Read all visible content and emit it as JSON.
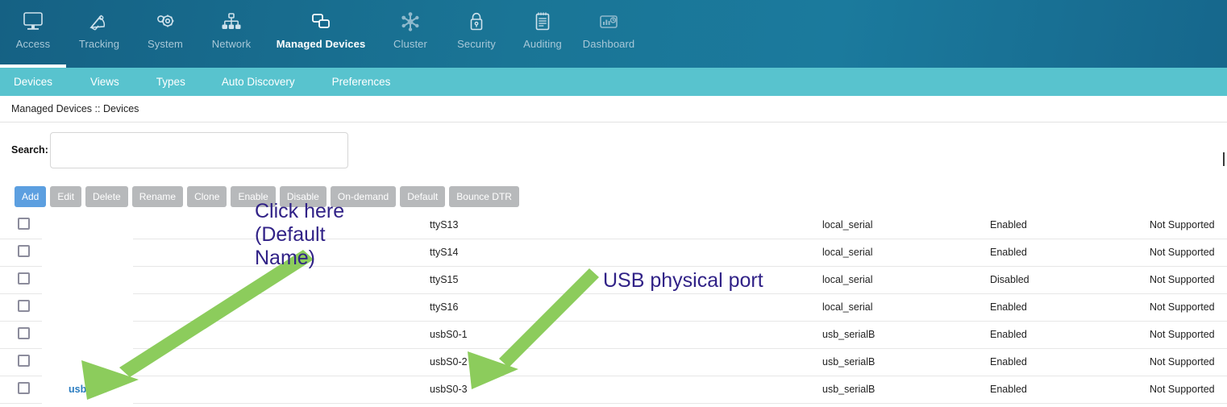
{
  "topnav": {
    "items": [
      {
        "label": "Access",
        "icon": "monitor-icon",
        "active": false
      },
      {
        "label": "Tracking",
        "icon": "satellite-dish-icon",
        "active": false
      },
      {
        "label": "System",
        "icon": "gears-icon",
        "active": false
      },
      {
        "label": "Network",
        "icon": "network-tree-icon",
        "active": false
      },
      {
        "label": "Managed Devices",
        "icon": "devices-stack-icon",
        "active": true
      },
      {
        "label": "Cluster",
        "icon": "cluster-nodes-icon",
        "active": false
      },
      {
        "label": "Security",
        "icon": "padlock-icon",
        "active": false
      },
      {
        "label": "Auditing",
        "icon": "notepad-icon",
        "active": false
      },
      {
        "label": "Dashboard",
        "icon": "dashboard-chart-icon",
        "active": false
      }
    ]
  },
  "subnav": {
    "items": [
      {
        "label": "Devices",
        "active": true
      },
      {
        "label": "Views",
        "active": false
      },
      {
        "label": "Types",
        "active": false
      },
      {
        "label": "Auto Discovery",
        "active": false
      },
      {
        "label": "Preferences",
        "active": false
      }
    ]
  },
  "breadcrumb": {
    "text": "Managed Devices :: Devices"
  },
  "search": {
    "label": "Search:",
    "value": "",
    "placeholder": ""
  },
  "toolbar": {
    "buttons": [
      {
        "label": "Add",
        "state": "enabled"
      },
      {
        "label": "Edit",
        "state": "disabled"
      },
      {
        "label": "Delete",
        "state": "disabled"
      },
      {
        "label": "Rename",
        "state": "disabled"
      },
      {
        "label": "Clone",
        "state": "disabled"
      },
      {
        "label": "Enable",
        "state": "disabled"
      },
      {
        "label": "Disable",
        "state": "disabled"
      },
      {
        "label": "On-demand",
        "state": "disabled"
      },
      {
        "label": "Default",
        "state": "disabled"
      },
      {
        "label": "Bounce DTR",
        "state": "disabled"
      }
    ]
  },
  "table": {
    "rows": [
      {
        "name": "",
        "alias": "",
        "port": "ttyS13",
        "type": "local_serial",
        "status": "Enabled",
        "power": "Not Supported"
      },
      {
        "name": "",
        "alias": "",
        "port": "ttyS14",
        "type": "local_serial",
        "status": "Enabled",
        "power": "Not Supported"
      },
      {
        "name": "",
        "alias": "",
        "port": "ttyS15",
        "type": "local_serial",
        "status": "Disabled",
        "power": "Not Supported"
      },
      {
        "name": "",
        "alias": "",
        "port": "ttyS16",
        "type": "local_serial",
        "status": "Enabled",
        "power": "Not Supported"
      },
      {
        "name": "",
        "alias": "",
        "port": "usbS0-1",
        "type": "usb_serialB",
        "status": "Enabled",
        "power": "Not Supported"
      },
      {
        "name": "",
        "alias": "",
        "port": "usbS0-2",
        "type": "usb_serialB",
        "status": "Enabled",
        "power": "Not Supported"
      },
      {
        "name": "usbS0-3",
        "alias": "",
        "port": "usbS0-3",
        "type": "usb_serialB",
        "status": "Enabled",
        "power": "Not Supported"
      }
    ]
  },
  "annotations": {
    "click_here": "Click here\n(Default\nName)",
    "usb_port": "USB physical port",
    "arrow_color": "#8ccc5c",
    "text_color": "#312287"
  },
  "colors": {
    "topnav_bg": "#17698e",
    "subnav_bg": "#58c3ce",
    "primary_button": "#5c9fe0",
    "disabled_button": "#b7b9bb",
    "link": "#2a7cc0"
  }
}
